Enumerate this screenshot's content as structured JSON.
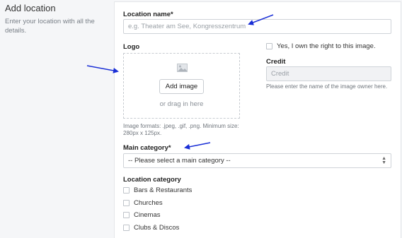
{
  "sidebar": {
    "title": "Add location",
    "description": "Enter your location with all the details."
  },
  "form": {
    "location_name": {
      "label": "Location name*",
      "placeholder": "e.g. Theater am See, Kongresszentrum"
    },
    "logo": {
      "label": "Logo",
      "add_button": "Add image",
      "drag_text": "or drag in here",
      "formats_hint": "Image formats: .jpeg, .gif, .png. Minimum size: 280px x 125px."
    },
    "rights_checkbox": {
      "label": "Yes, I own the right to this image."
    },
    "credit": {
      "label": "Credit",
      "placeholder": "Credit",
      "hint": "Please enter the name of the image owner here."
    },
    "main_category": {
      "label": "Main category*",
      "selected": "-- Please select a main category --"
    },
    "location_category": {
      "label": "Location category",
      "options": [
        "Bars & Restaurants",
        "Churches",
        "Cinemas",
        "Clubs & Discos"
      ]
    }
  },
  "colors": {
    "annotation_arrow": "#1a2fd6"
  },
  "icons": {
    "image_placeholder": "image-placeholder-icon",
    "select_caret": "updown-caret-icon"
  }
}
